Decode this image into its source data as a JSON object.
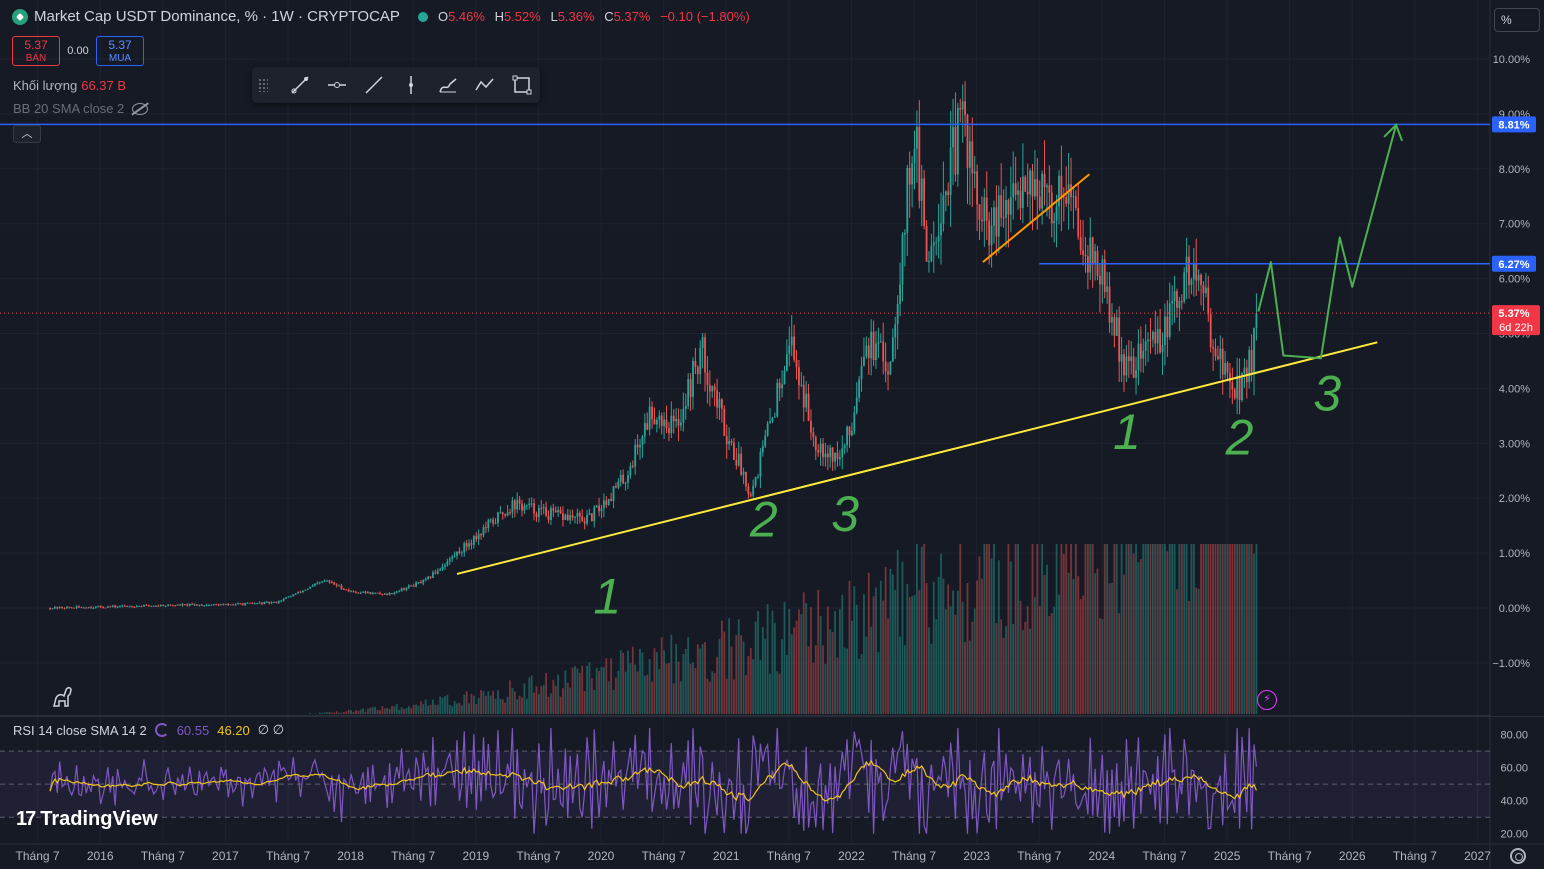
{
  "header": {
    "title": "Market Cap USDT Dominance, % · 1W · CRYPTOCAP",
    "ohlc": [
      {
        "k": "O",
        "v": "5.46%"
      },
      {
        "k": "H",
        "v": "5.52%"
      },
      {
        "k": "L",
        "v": "5.36%"
      },
      {
        "k": "C",
        "v": "5.37%"
      },
      {
        "k": "",
        "v": "−0.10 (−1.80%)"
      }
    ]
  },
  "trade": {
    "sell_price": "5.37",
    "sell_label": "BÁN",
    "spread": "0.00",
    "buy_price": "5.37",
    "buy_label": "MUA"
  },
  "volume_legend": {
    "label": "Khối lượng",
    "value": "66.37 B"
  },
  "bb_legend": {
    "label": "BB 20 SMA close 2"
  },
  "scale_button": "%",
  "rsi_legend": {
    "label": "RSI 14 close SMA 14 2",
    "rsi_value": "60.55",
    "sma_value": "46.20",
    "extra": "∅ ∅"
  },
  "branding": {
    "logo_text": "TradingView"
  },
  "colors": {
    "up": "#26a69a",
    "down": "#ef5350",
    "background": "#161a25",
    "level_line": "#2962ff",
    "trendline": "#ffeb3b",
    "annotation": "#4caf50",
    "orange": "#ff9800",
    "rsi": "#7e57c2",
    "rsi_sma": "#f0c419"
  },
  "chart_data": {
    "type": "candlestick",
    "title": "Market Cap USDT Dominance, %",
    "interval": "1W",
    "y_unit": "%",
    "ylim": [
      -2,
      11
    ],
    "y_ticks": [
      "10.00%",
      "9.00%",
      "8.00%",
      "7.00%",
      "6.00%",
      "5.00%",
      "4.00%",
      "3.00%",
      "2.00%",
      "1.00%",
      "0.00%",
      "−1.00%"
    ],
    "y_tick_values": [
      10,
      9,
      8,
      7,
      6,
      5,
      4,
      3,
      2,
      1,
      0,
      -1
    ],
    "x_range_years": [
      2015.2,
      2027.1
    ],
    "x_ticks": [
      {
        "label": "Tháng 7",
        "t": 2015.5
      },
      {
        "label": "2016",
        "t": 2016.0
      },
      {
        "label": "Tháng 7",
        "t": 2016.5
      },
      {
        "label": "2017",
        "t": 2017.0
      },
      {
        "label": "Tháng 7",
        "t": 2017.5
      },
      {
        "label": "2018",
        "t": 2018.0
      },
      {
        "label": "Tháng 7",
        "t": 2018.5
      },
      {
        "label": "2019",
        "t": 2019.0
      },
      {
        "label": "Tháng 7",
        "t": 2019.5
      },
      {
        "label": "2020",
        "t": 2020.0
      },
      {
        "label": "Tháng 7",
        "t": 2020.5
      },
      {
        "label": "2021",
        "t": 2021.0
      },
      {
        "label": "Tháng 7",
        "t": 2021.5
      },
      {
        "label": "2022",
        "t": 2022.0
      },
      {
        "label": "Tháng 7",
        "t": 2022.5
      },
      {
        "label": "2023",
        "t": 2023.0
      },
      {
        "label": "Tháng 7",
        "t": 2023.5
      },
      {
        "label": "2024",
        "t": 2024.0
      },
      {
        "label": "Tháng 7",
        "t": 2024.5
      },
      {
        "label": "2025",
        "t": 2025.0
      },
      {
        "label": "Tháng 7",
        "t": 2025.5
      },
      {
        "label": "2026",
        "t": 2026.0
      },
      {
        "label": "Tháng 7",
        "t": 2026.5
      },
      {
        "label": "2027",
        "t": 2027.0
      }
    ],
    "price_path": [
      [
        2015.6,
        0.0
      ],
      [
        2016.0,
        0.02
      ],
      [
        2016.5,
        0.05
      ],
      [
        2017.0,
        0.06
      ],
      [
        2017.4,
        0.1
      ],
      [
        2017.8,
        0.5
      ],
      [
        2018.0,
        0.3
      ],
      [
        2018.3,
        0.25
      ],
      [
        2018.6,
        0.5
      ],
      [
        2018.9,
        1.1
      ],
      [
        2019.3,
        1.9
      ],
      [
        2019.6,
        1.7
      ],
      [
        2019.9,
        1.6
      ],
      [
        2020.2,
        2.4
      ],
      [
        2020.4,
        3.6
      ],
      [
        2020.6,
        3.3
      ],
      [
        2020.8,
        4.7
      ],
      [
        2021.0,
        3.2
      ],
      [
        2021.2,
        2.1
      ],
      [
        2021.4,
        3.8
      ],
      [
        2021.5,
        5.0
      ],
      [
        2021.7,
        3.1
      ],
      [
        2021.9,
        2.7
      ],
      [
        2022.0,
        3.3
      ],
      [
        2022.1,
        4.9
      ],
      [
        2022.3,
        4.4
      ],
      [
        2022.4,
        6.5
      ],
      [
        2022.5,
        8.8
      ],
      [
        2022.6,
        6.4
      ],
      [
        2022.8,
        8.1
      ],
      [
        2022.9,
        9.0
      ],
      [
        2023.0,
        7.3
      ],
      [
        2023.1,
        6.8
      ],
      [
        2023.3,
        7.4
      ],
      [
        2023.4,
        8.0
      ],
      [
        2023.6,
        7.2
      ],
      [
        2023.7,
        7.9
      ],
      [
        2023.8,
        7.0
      ],
      [
        2024.0,
        6.0
      ],
      [
        2024.1,
        5.1
      ],
      [
        2024.2,
        4.3
      ],
      [
        2024.3,
        4.6
      ],
      [
        2024.4,
        4.9
      ],
      [
        2024.5,
        5.0
      ],
      [
        2024.6,
        5.6
      ],
      [
        2024.7,
        6.2
      ],
      [
        2024.8,
        5.8
      ],
      [
        2024.9,
        4.8
      ],
      [
        2025.0,
        4.2
      ],
      [
        2025.1,
        4.0
      ],
      [
        2025.2,
        4.6
      ],
      [
        2025.25,
        5.37
      ]
    ],
    "last_price": 5.37,
    "last_price_label": "5.37%",
    "countdown_label": "6d 22h",
    "levels": [
      {
        "value": 8.81,
        "label": "8.81%",
        "from": 2015.2
      },
      {
        "value": 6.27,
        "label": "6.27%",
        "from": 2023.5
      }
    ],
    "support_trendline": [
      [
        2018.85,
        0.62
      ],
      [
        2026.2,
        4.84
      ]
    ],
    "orange_trendline": [
      [
        2023.05,
        6.3
      ],
      [
        2023.9,
        7.9
      ]
    ],
    "projection_path": [
      [
        2025.25,
        5.4
      ],
      [
        2025.35,
        6.3
      ],
      [
        2025.45,
        4.6
      ],
      [
        2025.75,
        4.55
      ],
      [
        2025.9,
        6.75
      ],
      [
        2026.0,
        5.85
      ],
      [
        2026.35,
        8.8
      ]
    ],
    "wave_labels": [
      {
        "text": "1",
        "t": 2020.05,
        "y": -0.1
      },
      {
        "text": "2",
        "t": 2021.3,
        "y": 1.3
      },
      {
        "text": "3",
        "t": 2021.95,
        "y": 1.4
      },
      {
        "text": "1",
        "t": 2024.2,
        "y": 2.9
      },
      {
        "text": "2",
        "t": 2025.1,
        "y": 2.8
      },
      {
        "text": "3",
        "t": 2025.8,
        "y": 3.6
      }
    ],
    "volume_note": "Volume histogram shown at bottom of price pane",
    "rsi": {
      "ylim": [
        15,
        90
      ],
      "y_ticks": [
        "80.00",
        "60.00",
        "40.00",
        "20.00"
      ],
      "y_tick_values": [
        80,
        60,
        40,
        20
      ],
      "upper_band": 70,
      "middle_band": 50,
      "lower_band": 30,
      "last_rsi": 60.55,
      "last_sma": 46.2
    }
  }
}
